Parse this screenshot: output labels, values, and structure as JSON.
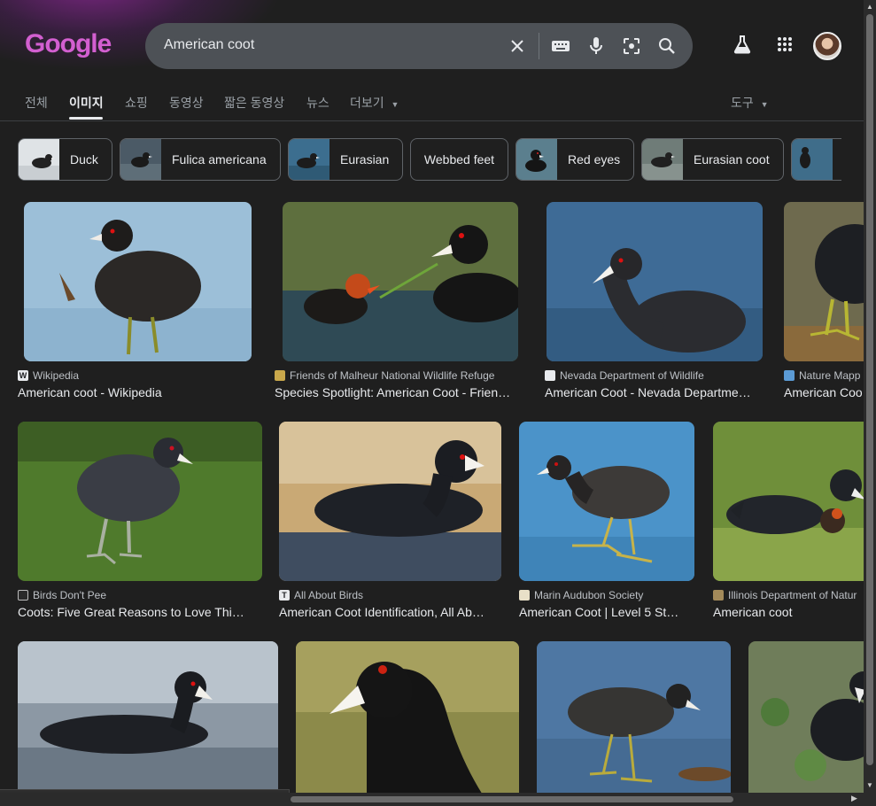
{
  "header": {
    "logo": "Google",
    "search": {
      "value": "American coot"
    }
  },
  "tabs": [
    {
      "label": "전체",
      "active": false
    },
    {
      "label": "이미지",
      "active": true
    },
    {
      "label": "쇼핑",
      "active": false
    },
    {
      "label": "동영상",
      "active": false
    },
    {
      "label": "짧은 동영상",
      "active": false
    },
    {
      "label": "뉴스",
      "active": false
    },
    {
      "label": "더보기",
      "active": false
    }
  ],
  "tools_label": "도구",
  "chips": [
    "Duck",
    "Fulica americana",
    "Eurasian",
    "Webbed feet",
    "Red eyes",
    "Eurasian coot"
  ],
  "results": [
    {
      "source": "Wikipedia",
      "title": "American coot - Wikipedia"
    },
    {
      "source": "Friends of Malheur National Wildlife Refuge",
      "title": "Species Spotlight: American Coot - Frien…"
    },
    {
      "source": "Nevada Department of Wildlife",
      "title": "American Coot - Nevada Departme…"
    },
    {
      "source": "Nature Mapp",
      "title": "American Coo"
    },
    {
      "source": "Birds Don't Pee",
      "title": "Coots: Five Great Reasons to Love Thi…"
    },
    {
      "source": "All About Birds",
      "title": "American Coot Identification, All Ab…"
    },
    {
      "source": "Marin Audubon Society",
      "title": "American Coot | Level 5 St…"
    },
    {
      "source": "Illinois Department of Natur",
      "title": "American coot"
    }
  ],
  "status_url": "https://www.google.com/search?sca_esv=99e589f3edfeb…",
  "colors": {
    "background": "#1f1f1f",
    "search_box": "#4d5156",
    "logo": "#d35fd0"
  }
}
